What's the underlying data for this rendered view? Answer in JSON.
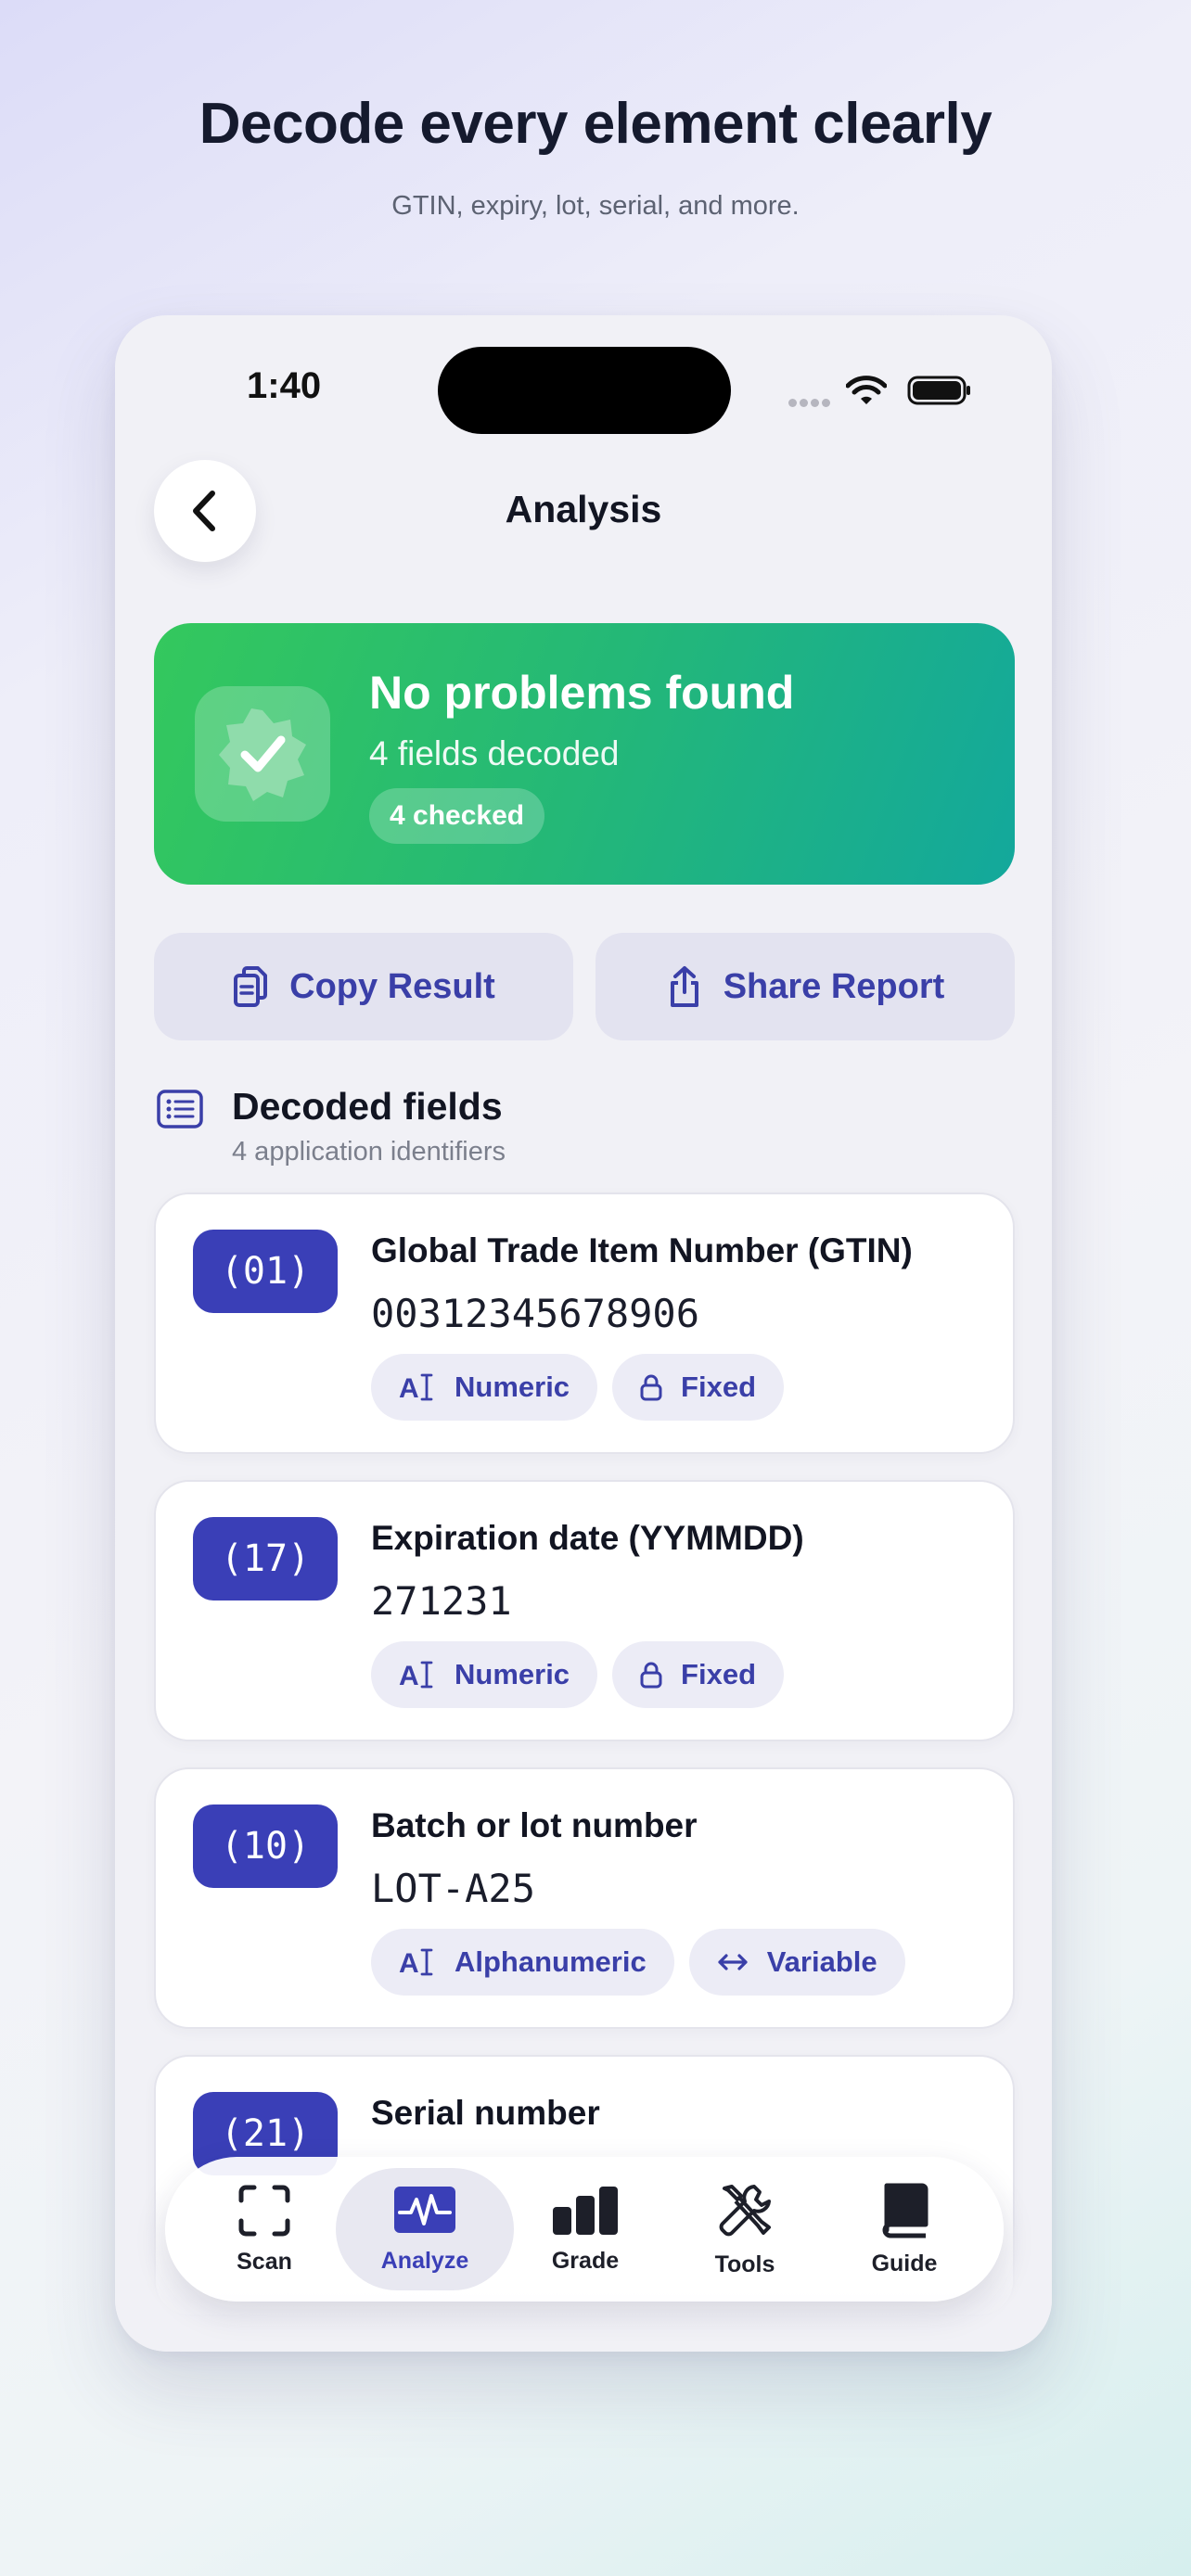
{
  "promo": {
    "headline": "Decode every element clearly",
    "subhead": "GTIN, expiry, lot, serial, and more."
  },
  "status_bar": {
    "time": "1:40"
  },
  "nav": {
    "title": "Analysis",
    "back_icon": "chevron-left-icon"
  },
  "banner": {
    "title": "No problems found",
    "subtitle": "4 fields decoded",
    "pill": "4 checked",
    "icon": "verified-badge-icon",
    "gradient": [
      "#34c85d",
      "#13a89c"
    ]
  },
  "actions": {
    "copy_label": "Copy Result",
    "share_label": "Share Report"
  },
  "section": {
    "title": "Decoded fields",
    "subtitle": "4 application identifiers"
  },
  "fields": [
    {
      "ai": "(01)",
      "title": "Global Trade Item Number (GTIN)",
      "value": "00312345678906",
      "type": "Numeric",
      "length": "Fixed"
    },
    {
      "ai": "(17)",
      "title": "Expiration date (YYMMDD)",
      "value": "271231",
      "type": "Numeric",
      "length": "Fixed"
    },
    {
      "ai": "(10)",
      "title": "Batch or lot number",
      "value": "LOT-A25",
      "type": "Alphanumeric",
      "length": "Variable"
    },
    {
      "ai": "(21)",
      "title": "Serial number"
    }
  ],
  "tabs": [
    {
      "label": "Scan",
      "icon": "scan-frame-icon"
    },
    {
      "label": "Analyze",
      "icon": "waveform-icon",
      "active": true
    },
    {
      "label": "Grade",
      "icon": "bar-chart-icon"
    },
    {
      "label": "Tools",
      "icon": "tools-icon"
    },
    {
      "label": "Guide",
      "icon": "book-icon"
    }
  ],
  "colors": {
    "accent": "#3a3fb7",
    "accent_text": "#3a3fa8",
    "success_start": "#34c85d",
    "success_end": "#13a89c"
  }
}
